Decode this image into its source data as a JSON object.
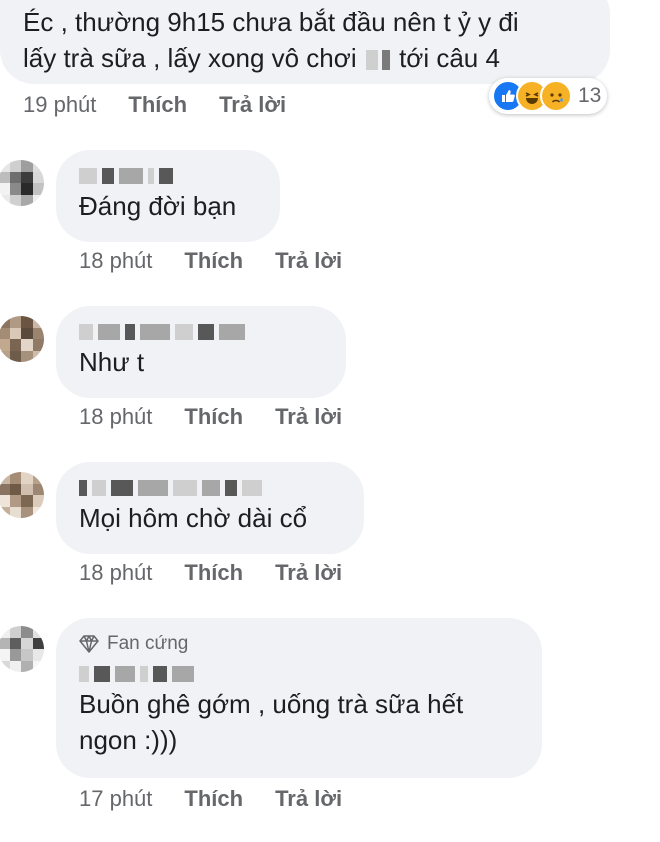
{
  "actions": {
    "like": "Thích",
    "reply": "Trả lời"
  },
  "top_comment": {
    "line1": "Éc , thường 9h15 chưa bắt đầu nên t ỷ y đi",
    "line2_a": "lấy trà sữa , lấy xong vô chơi",
    "line2_b": "tới câu 4",
    "time": "19 phút",
    "reaction_count": "13",
    "reaction_icons": [
      "like-icon",
      "haha-icon",
      "sad-icon"
    ]
  },
  "replies": [
    {
      "text": "Đáng đời bạn",
      "time": "18 phút"
    },
    {
      "text": "Như t",
      "time": "18 phút"
    },
    {
      "text": "Mọi hôm chờ dài cổ",
      "time": "18 phút"
    },
    {
      "badge": "Fan cứng",
      "badge_icon": "diamond-icon",
      "text_line1": "Buồn ghê gớm , uống trà sữa hết",
      "text_line2": "ngon :)))",
      "time": "17 phút"
    }
  ],
  "colors": {
    "bubble": "#f0f2f5",
    "meta": "#65676b",
    "text": "#1c1e21",
    "like": "#1877f2",
    "emoji": "#f7b125"
  }
}
